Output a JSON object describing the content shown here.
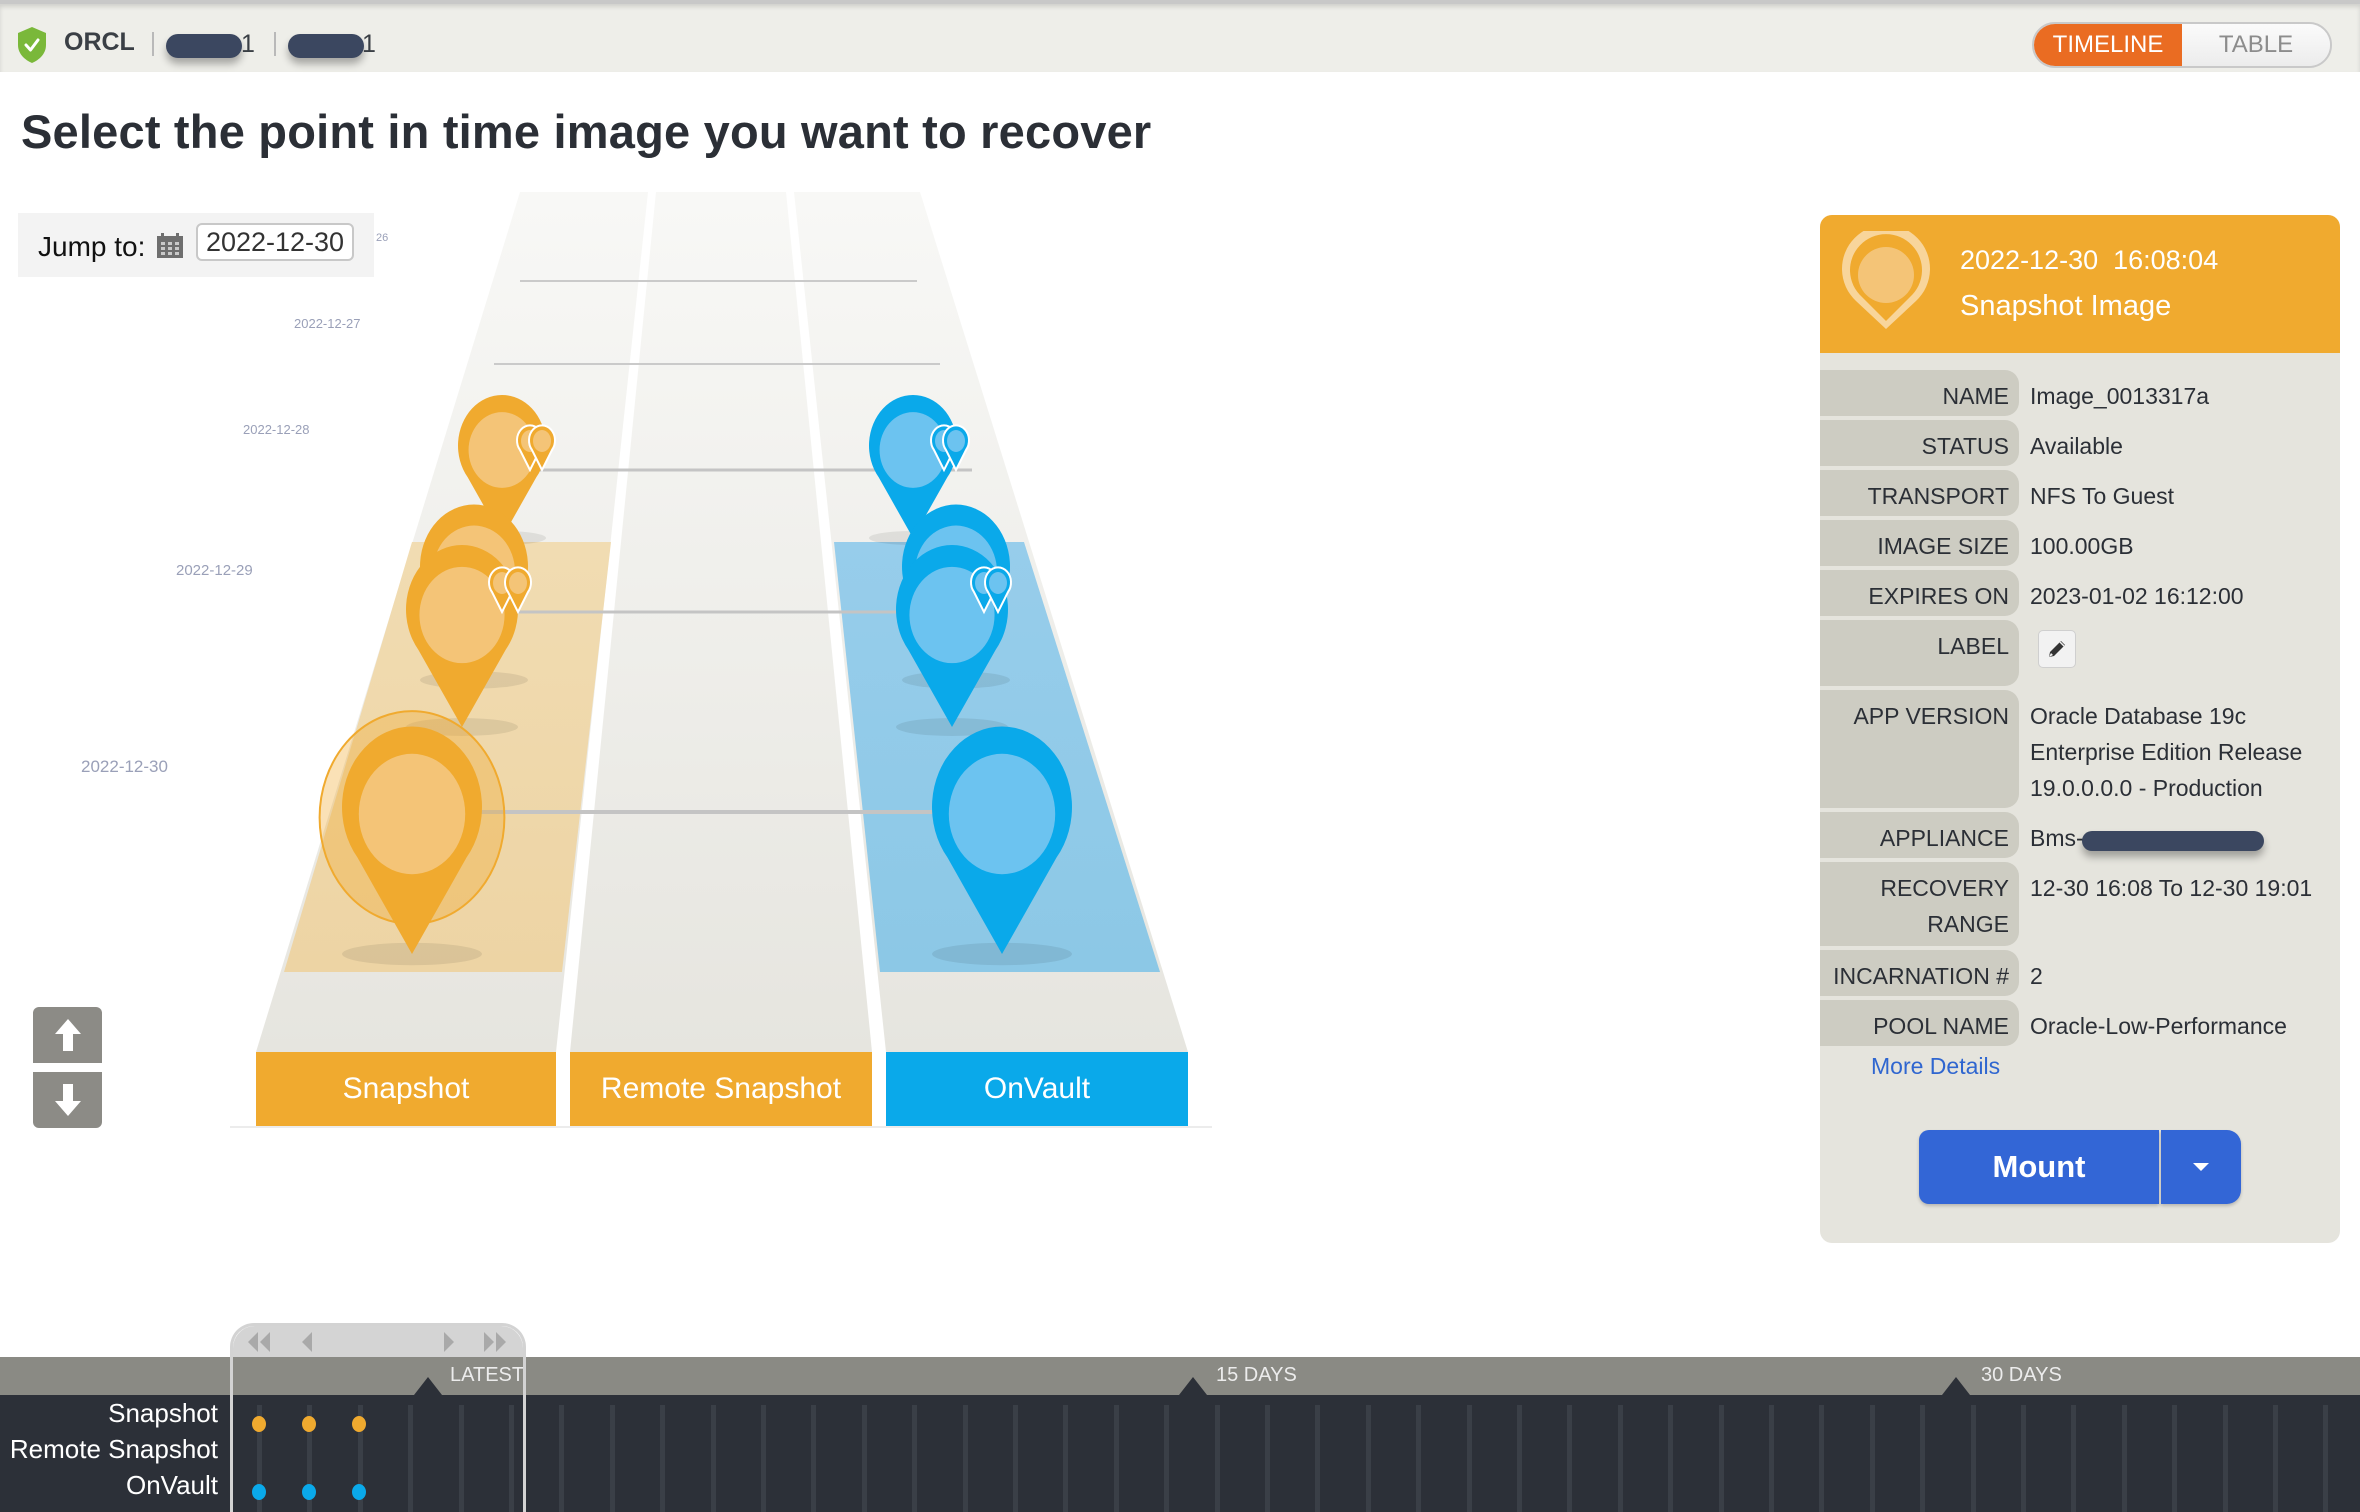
{
  "topbar": {
    "app_name": "ORCL",
    "breadcrumb_suffixes": [
      "1",
      "1"
    ],
    "view_toggle": {
      "options": [
        "TIMELINE",
        "TABLE"
      ],
      "selected": "TIMELINE"
    }
  },
  "heading": "Select the point in time image you want to recover",
  "jump_to": {
    "label": "Jump to:",
    "value": "2022-12-30"
  },
  "timeline_dates": [
    "26",
    "2022-12-27",
    "2022-12-28",
    "2022-12-29",
    "2022-12-30"
  ],
  "lanes": [
    {
      "label": "Snapshot",
      "color": "#f0aa2f"
    },
    {
      "label": "Remote Snapshot",
      "color": "#f0aa2f"
    },
    {
      "label": "OnVault",
      "color": "#0aa9ea"
    }
  ],
  "selected_image": {
    "datetime": "2022-12-30  16:08:04",
    "type": "Snapshot Image",
    "fields": [
      {
        "key": "NAME",
        "value": "Image_0013317a"
      },
      {
        "key": "STATUS",
        "value": "Available"
      },
      {
        "key": "TRANSPORT",
        "value": "NFS To Guest"
      },
      {
        "key": "IMAGE SIZE",
        "value": "100.00GB"
      },
      {
        "key": "EXPIRES ON",
        "value": "2023-01-02 16:12:00"
      },
      {
        "key": "LABEL",
        "value": ""
      },
      {
        "key": "APP VERSION",
        "value": "Oracle Database 19c Enterprise Edition Release 19.0.0.0.0 - Production"
      },
      {
        "key": "APPLIANCE",
        "value": "Bms-"
      },
      {
        "key": "RECOVERY RANGE",
        "value": "12-30 16:08 To 12-30 19:01"
      },
      {
        "key": "INCARNATION #",
        "value": "2"
      },
      {
        "key": "POOL NAME",
        "value": "Oracle-Low-Performance"
      }
    ],
    "more_details": "More Details",
    "mount_label": "Mount"
  },
  "bottom_timeline": {
    "row_labels": [
      "Snapshot",
      "Remote Snapshot",
      "OnVault"
    ],
    "markers": [
      "LATEST",
      "15 DAYS",
      "30 DAYS"
    ],
    "snapshot_dots": 3,
    "onvault_dots": 3
  },
  "colors": {
    "snapshot": "#f0aa2f",
    "onvault": "#0aa9ea",
    "toggle_active": "#ea6c22",
    "mount": "#3366d6",
    "link": "#2f66d0"
  }
}
